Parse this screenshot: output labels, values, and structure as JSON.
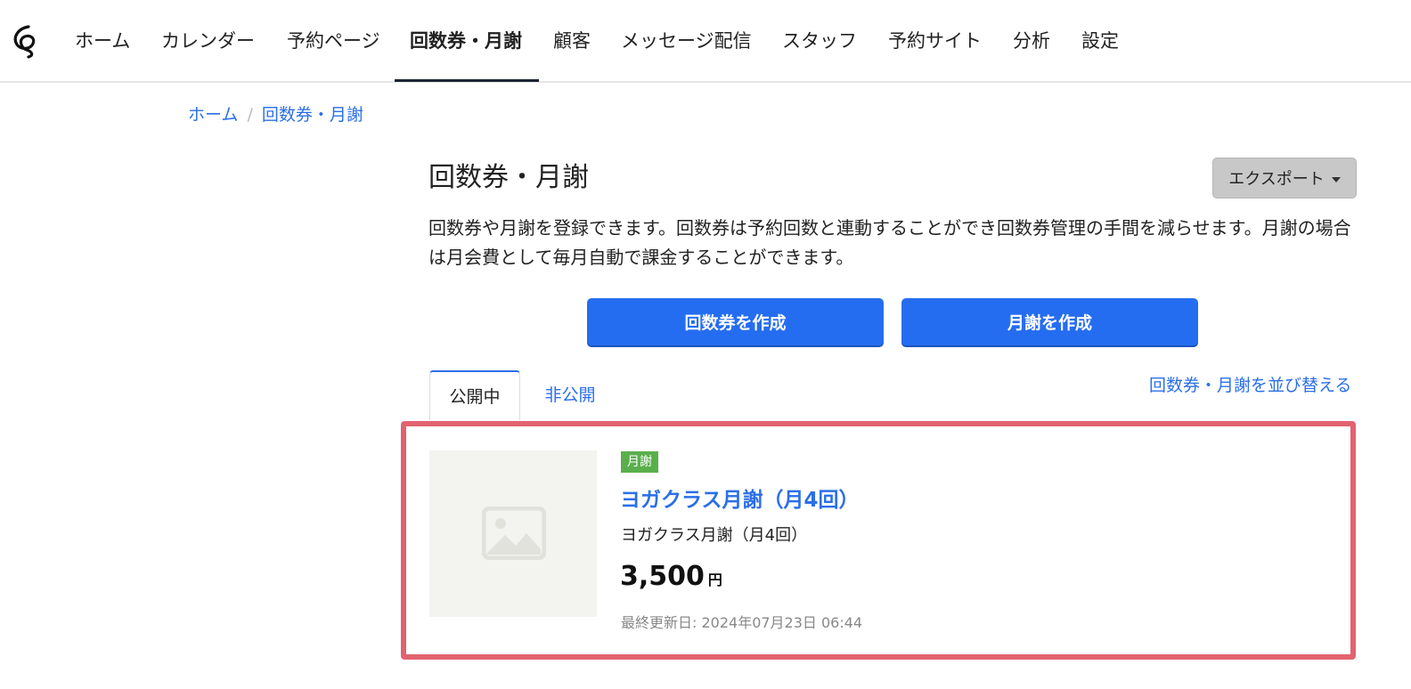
{
  "nav": {
    "items": [
      {
        "label": "ホーム"
      },
      {
        "label": "カレンダー"
      },
      {
        "label": "予約ページ"
      },
      {
        "label": "回数券・月謝",
        "active": true
      },
      {
        "label": "顧客"
      },
      {
        "label": "メッセージ配信"
      },
      {
        "label": "スタッフ"
      },
      {
        "label": "予約サイト"
      },
      {
        "label": "分析"
      },
      {
        "label": "設定"
      }
    ]
  },
  "breadcrumb": {
    "home": "ホーム",
    "current": "回数券・月謝",
    "separator": "/"
  },
  "page": {
    "title": "回数券・月謝",
    "export_label": "エクスポート",
    "description": "回数券や月謝を登録できます。回数券は予約回数と連動することができ回数券管理の手間を減らせます。月謝の場合は月会費として毎月自動で課金することができます。",
    "create_ticket_label": "回数券を作成",
    "create_monthly_label": "月謝を作成"
  },
  "tabs": [
    {
      "label": "公開中",
      "active": true
    },
    {
      "label": "非公開",
      "active": false
    }
  ],
  "sort_link": "回数券・月謝を並び替える",
  "items": [
    {
      "badge": "月謝",
      "title": "ヨガクラス月謝（月4回）",
      "description": "ヨガクラス月謝（月4回）",
      "price": "3,500",
      "currency": "円",
      "updated": "最終更新日: 2024年07月23日 06:44"
    }
  ],
  "colors": {
    "accent": "#256df0",
    "link": "#2b6fe8",
    "badge": "#5aaf4c",
    "highlight": "#e2636f"
  }
}
